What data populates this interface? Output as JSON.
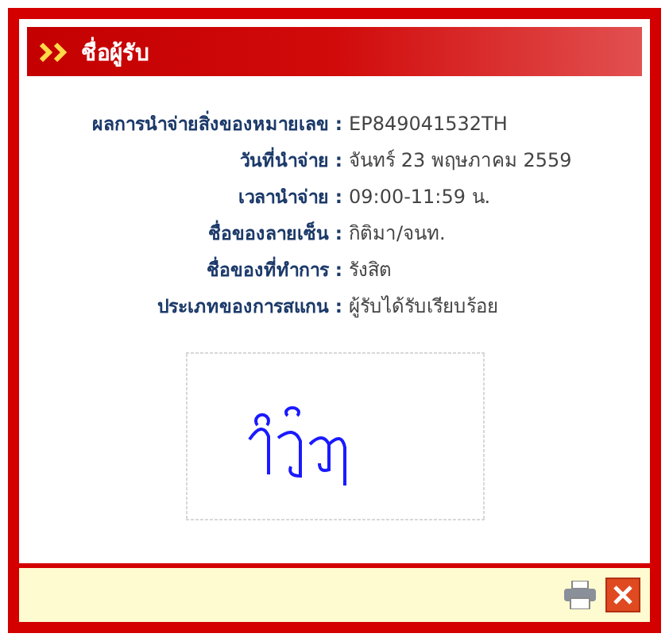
{
  "header": {
    "title": "ชื่อผู้รับ"
  },
  "fields": [
    {
      "label": "ผลการนำจ่ายสิ่งของหมายเลข :",
      "value": "EP849041532TH"
    },
    {
      "label": "วันที่นำจ่าย :",
      "value": "จันทร์ 23 พฤษภาคม 2559"
    },
    {
      "label": "เวลานำจ่าย :",
      "value": "09:00-11:59 น."
    },
    {
      "label": "ชื่อของลายเซ็น :",
      "value": "กิติมา/จนท."
    },
    {
      "label": "ชื่อของที่ทำการ :",
      "value": "รังสิต"
    },
    {
      "label": "ประเภทของการสแกน :",
      "value": "ผู้รับได้รับเรียบร้อย"
    }
  ]
}
